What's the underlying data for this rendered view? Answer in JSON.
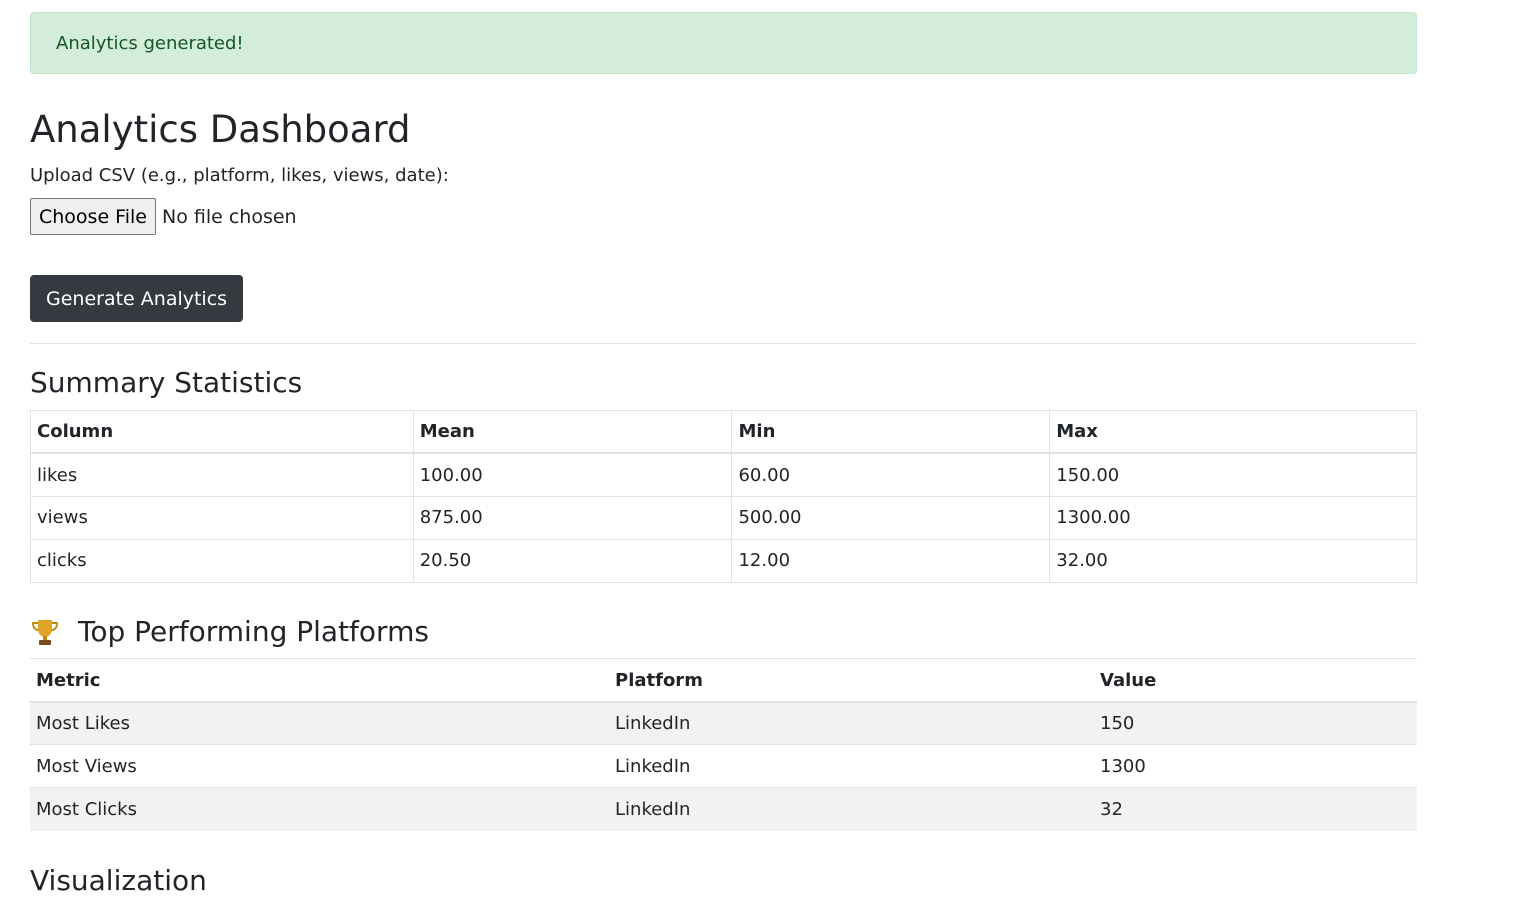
{
  "alert": {
    "message": "Analytics generated!"
  },
  "page": {
    "title": "Analytics Dashboard"
  },
  "upload": {
    "label": "Upload CSV (e.g., platform, likes, views, date):",
    "choose_button": "Choose File",
    "file_status": "No file chosen"
  },
  "generate_button": "Generate Analytics",
  "summary": {
    "title": "Summary Statistics",
    "headers": [
      "Column",
      "Mean",
      "Min",
      "Max"
    ],
    "rows": [
      [
        "likes",
        "100.00",
        "60.00",
        "150.00"
      ],
      [
        "views",
        "875.00",
        "500.00",
        "1300.00"
      ],
      [
        "clicks",
        "20.50",
        "12.00",
        "32.00"
      ]
    ]
  },
  "top": {
    "icon": "trophy-icon",
    "title": "Top Performing Platforms",
    "headers": [
      "Metric",
      "Platform",
      "Value"
    ],
    "rows": [
      [
        "Most Likes",
        "LinkedIn",
        "150"
      ],
      [
        "Most Views",
        "LinkedIn",
        "1300"
      ],
      [
        "Most Clicks",
        "LinkedIn",
        "32"
      ]
    ]
  },
  "visualization": {
    "title": "Visualization"
  },
  "colors": {
    "alert_bg": "#d4edda",
    "alert_text": "#155724",
    "primary_button": "#343a40"
  }
}
